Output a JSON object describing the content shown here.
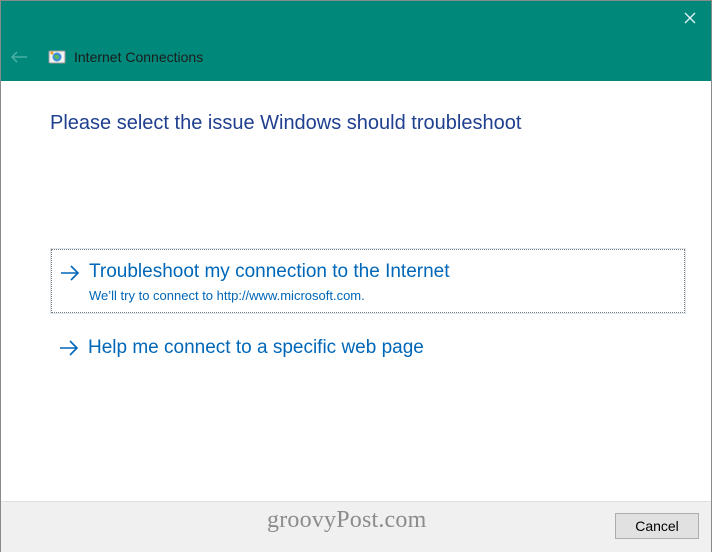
{
  "window": {
    "title": "Internet Connections",
    "icons": {
      "back": "back-arrow-icon",
      "app": "network-globe-icon",
      "close": "close-icon"
    },
    "titlebar_color": "#00897b"
  },
  "main": {
    "heading": "Please select the issue Windows should troubleshoot",
    "options": [
      {
        "title": "Troubleshoot my connection to the Internet",
        "description": "We’ll try to connect to http://www.microsoft.com.",
        "icon": "right-arrow-icon",
        "focused": true
      },
      {
        "title": "Help me connect to a specific web page",
        "icon": "right-arrow-icon",
        "focused": false
      }
    ],
    "link_color": "#0067b8",
    "heading_color": "#1f3f8f"
  },
  "footer": {
    "watermark": "groovyPost.com",
    "cancel_label": "Cancel"
  }
}
